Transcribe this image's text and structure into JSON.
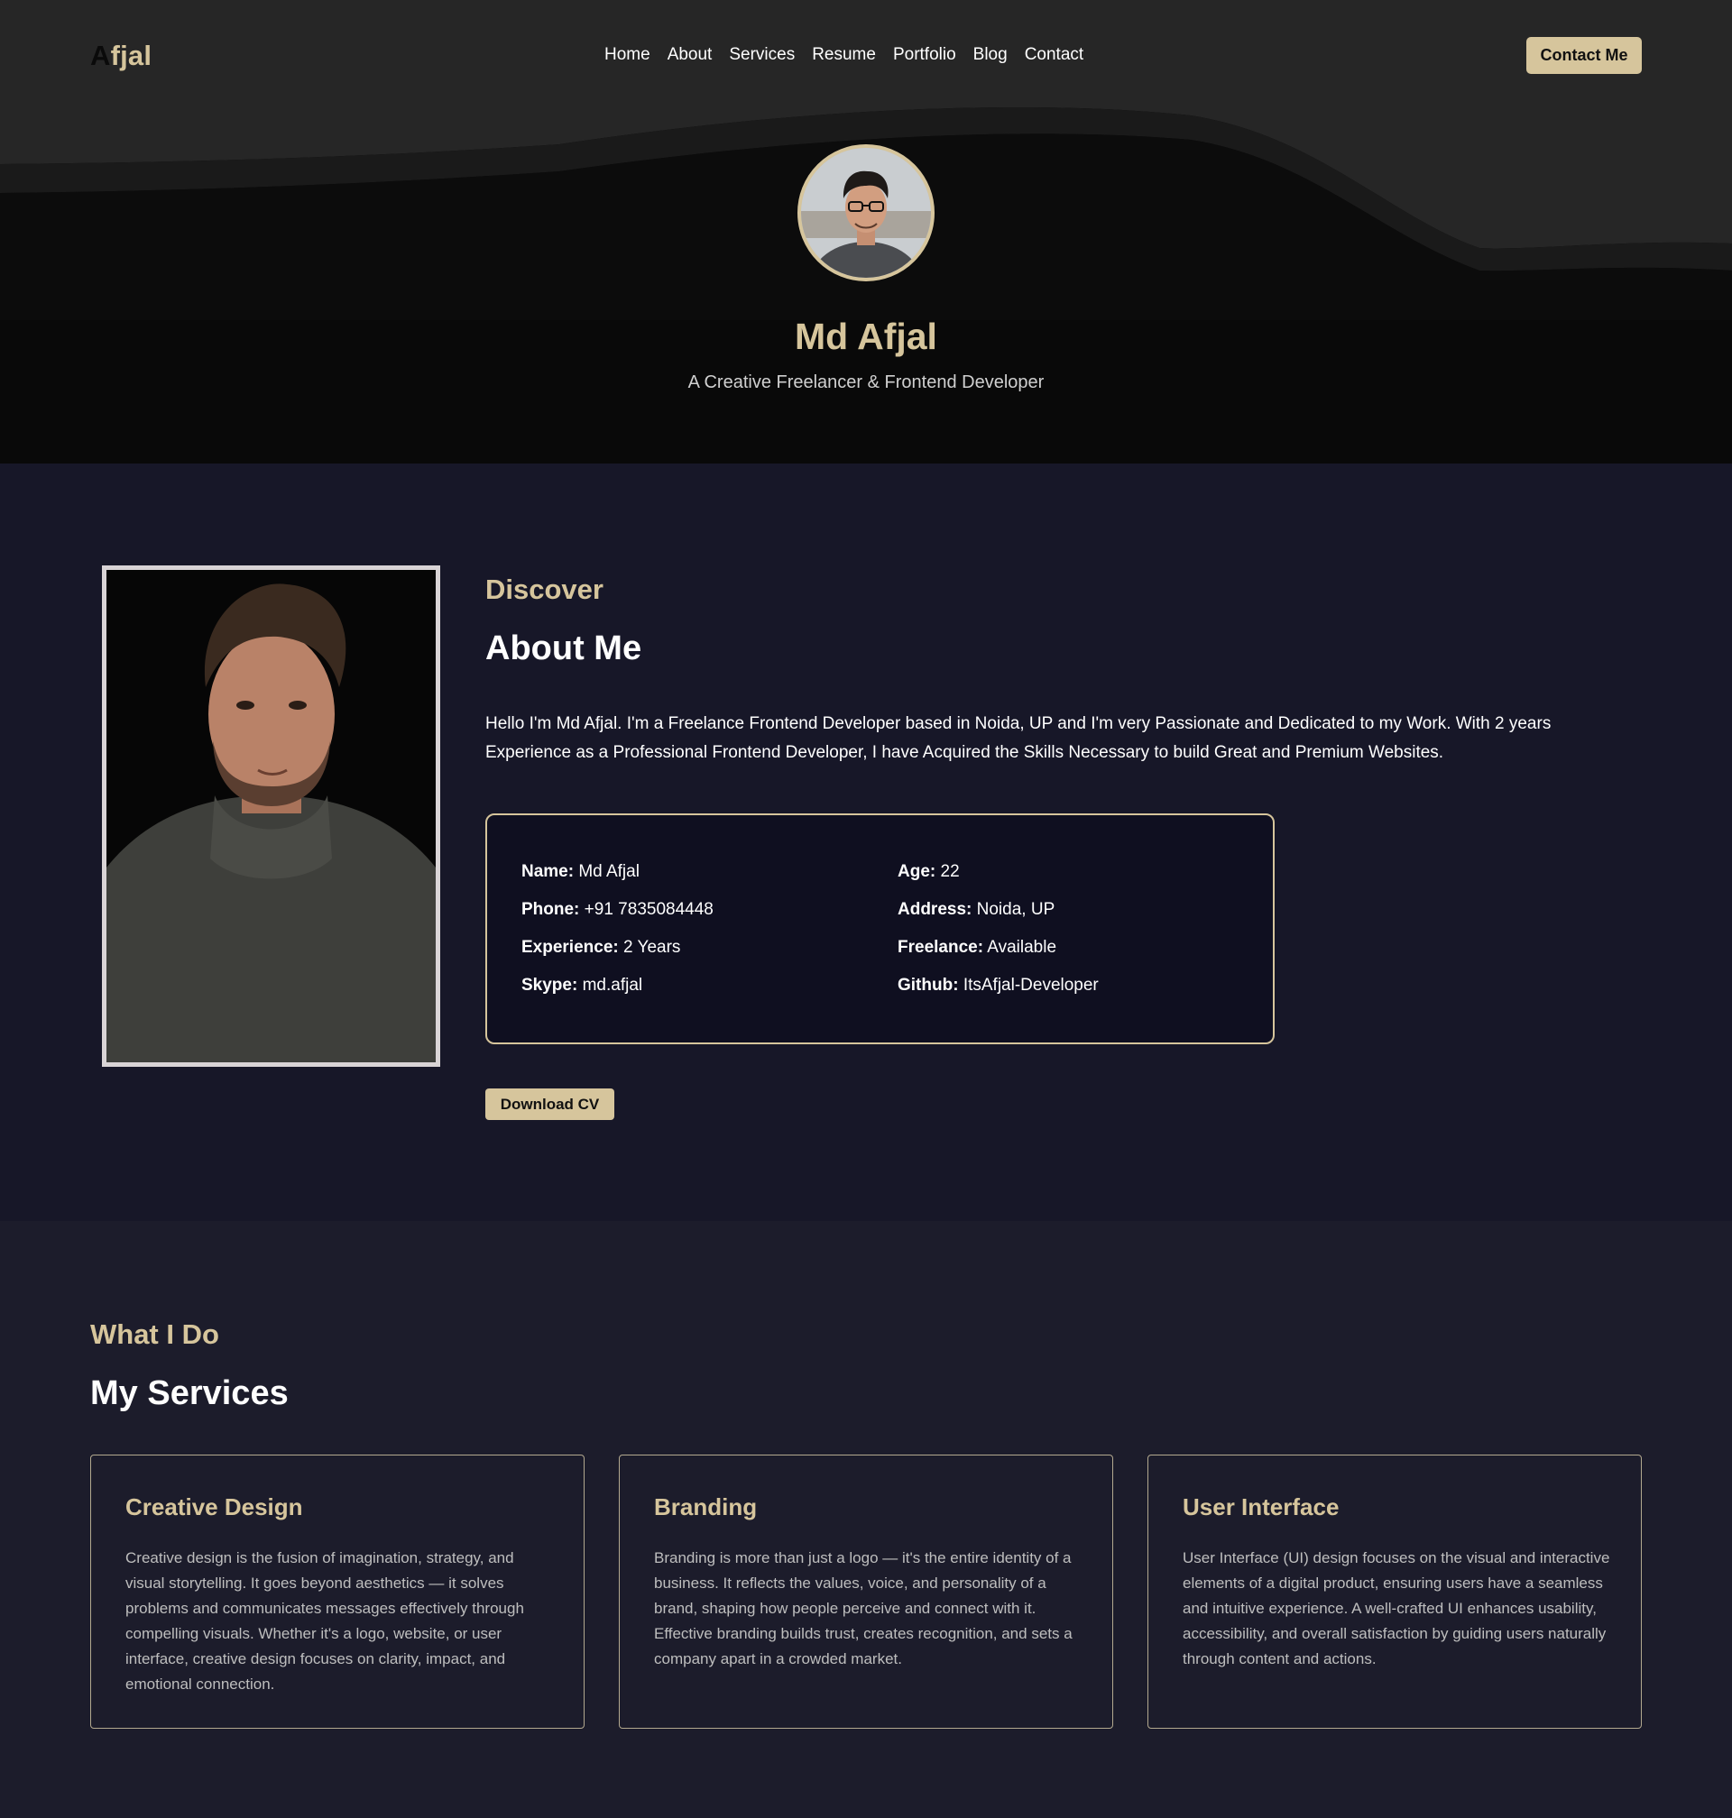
{
  "nav": {
    "logo_first": "A",
    "logo_rest": "fjal",
    "links": [
      "Home",
      "About",
      "Services",
      "Resume",
      "Portfolio",
      "Blog",
      "Contact"
    ],
    "cta": "Contact Me"
  },
  "hero": {
    "name": "Md Afjal",
    "tagline": "A Creative Freelancer & Frontend Developer"
  },
  "about": {
    "kicker": "Discover",
    "title": "About Me",
    "text": "Hello I'm Md Afjal. I'm a Freelance Frontend Developer based in Noida, UP and I'm very Passionate and Dedicated to my Work. With 2 years Experience as a Professional Frontend Developer, I have Acquired the Skills Necessary to build Great and Premium Websites.",
    "info": [
      {
        "label": "Name:",
        "value": "Md Afjal"
      },
      {
        "label": "Phone:",
        "value": "+91 7835084448"
      },
      {
        "label": "Experience:",
        "value": "2 Years"
      },
      {
        "label": "Skype:",
        "value": "md.afjal"
      },
      {
        "label": "Age:",
        "value": "22"
      },
      {
        "label": "Address:",
        "value": "Noida, UP"
      },
      {
        "label": "Freelance:",
        "value": "Available"
      },
      {
        "label": "Github:",
        "value": "ItsAfjal-Developer"
      }
    ],
    "cv_button": "Download CV"
  },
  "services": {
    "kicker": "What I Do",
    "title": "My Services",
    "cards": [
      {
        "title": "Creative Design",
        "text": "Creative design is the fusion of imagination, strategy, and visual storytelling. It goes beyond aesthetics — it solves problems and communicates messages effectively through compelling visuals. Whether it's a logo, website, or user interface, creative design focuses on clarity, impact, and emotional connection."
      },
      {
        "title": "Branding",
        "text": "Branding is more than just a logo — it's the entire identity of a business. It reflects the values, voice, and personality of a brand, shaping how people perceive and connect with it. Effective branding builds trust, creates recognition, and sets a company apart in a crowded market."
      },
      {
        "title": "User Interface",
        "text": "User Interface (UI) design focuses on the visual and interactive elements of a digital product, ensuring users have a seamless and intuitive experience. A well-crafted UI enhances usability, accessibility, and overall satisfaction by guiding users naturally through content and actions."
      }
    ]
  },
  "colors": {
    "accent": "#d6c59c",
    "hero_bg": "#080808",
    "about_bg": "#171728",
    "services_bg": "#1c1c2b"
  }
}
